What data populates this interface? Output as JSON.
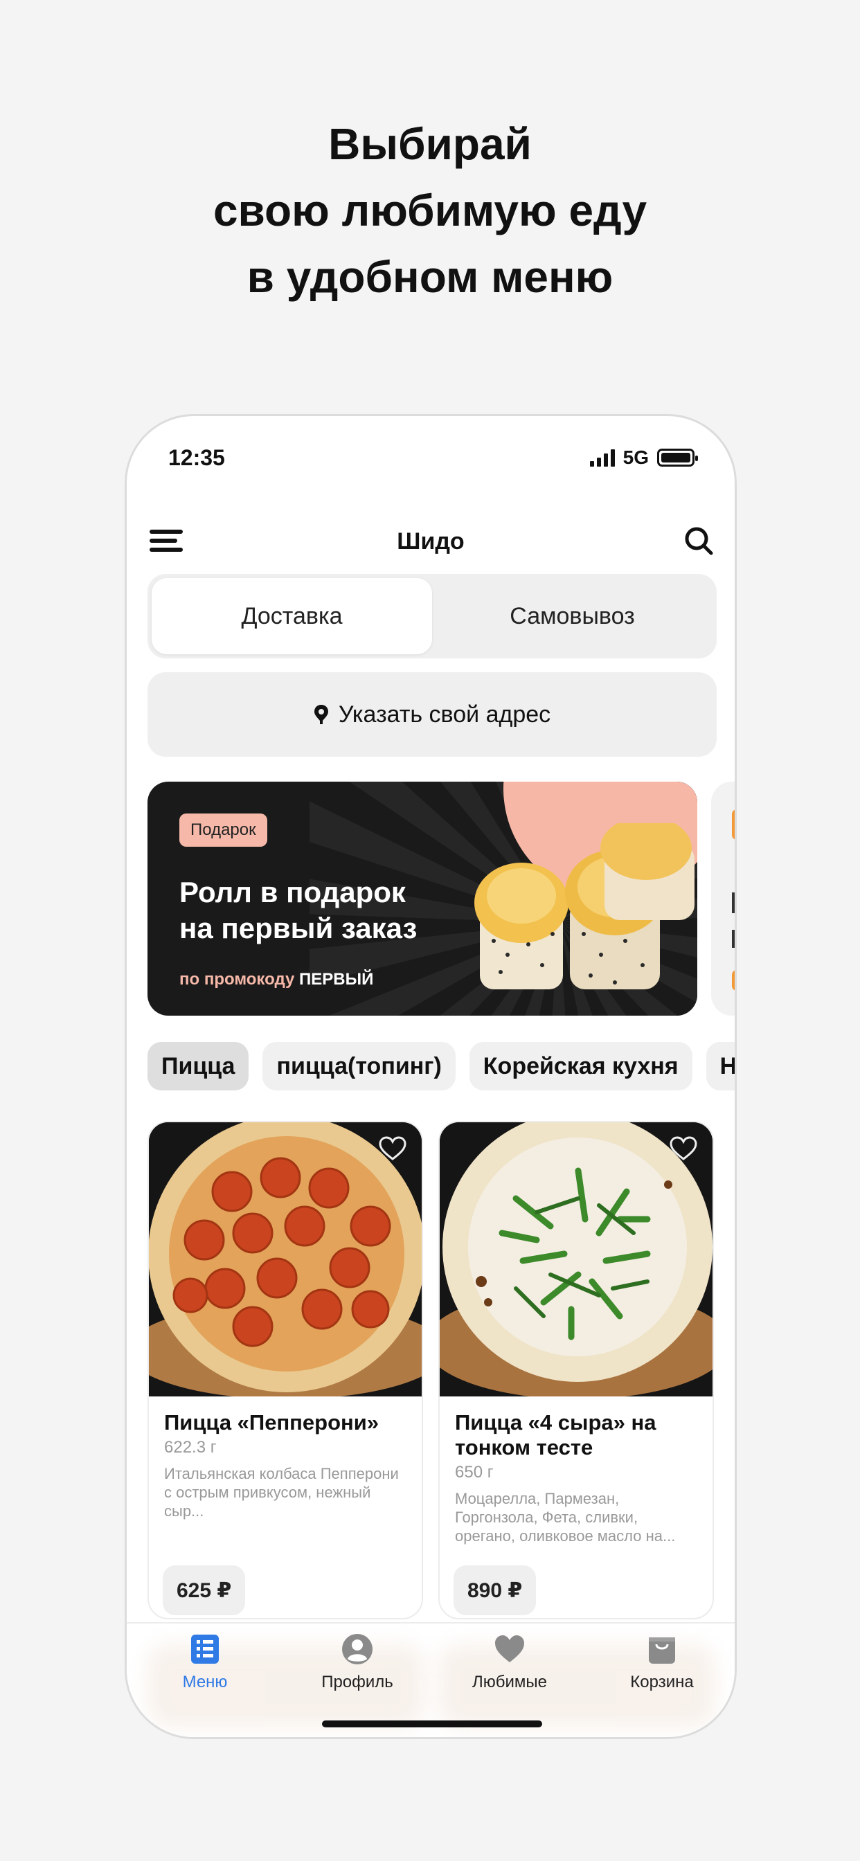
{
  "headline": {
    "line1": "Выбирай",
    "line2": "свою любимую еду",
    "line3": "в удобном меню"
  },
  "status_bar": {
    "time": "12:35",
    "network": "5G"
  },
  "header": {
    "title": "Шидо",
    "menu_icon": "hamburger-icon",
    "search_icon": "search-icon"
  },
  "delivery_toggle": {
    "options": [
      "Доставка",
      "Самовывоз"
    ],
    "selected": "Доставка"
  },
  "address": {
    "label": "Указать свой адрес",
    "icon": "location-pin-icon"
  },
  "banner": {
    "tag": "Подарок",
    "heading_line1": "Ролл в подарок",
    "heading_line2": "на первый заказ",
    "promo_prefix": "по промокоду",
    "promo_code": "ПЕРВЫЙ"
  },
  "categories": [
    "Пицца",
    "пицца(топинг)",
    "Корейская кухня",
    "Н"
  ],
  "selected_category": "Пицца",
  "products": [
    {
      "name": "Пицца «Пепперони»",
      "weight": "622.3 г",
      "description": "Итальянская колбаса Пепперони с острым привкусом, нежный сыр...",
      "price": "625 ₽"
    },
    {
      "name": "Пицца «4 сыра» на тонком тесте",
      "weight": "650 г",
      "description": "Моцарелла, Пармезан, Горгонзола, Фета, сливки, орегано, оливковое масло на...",
      "price": "890 ₽"
    }
  ],
  "tab_bar": {
    "items": [
      {
        "label": "Меню",
        "icon": "menu-list-icon"
      },
      {
        "label": "Профиль",
        "icon": "profile-icon"
      },
      {
        "label": "Любимые",
        "icon": "heart-icon"
      },
      {
        "label": "Корзина",
        "icon": "bag-icon"
      }
    ],
    "active": "Меню"
  },
  "colors": {
    "accent": "#2f7ae5",
    "banner_bg": "#1a1a1a",
    "banner_tag": "#f6b9a9",
    "chip_bg": "#f0f0f0"
  }
}
